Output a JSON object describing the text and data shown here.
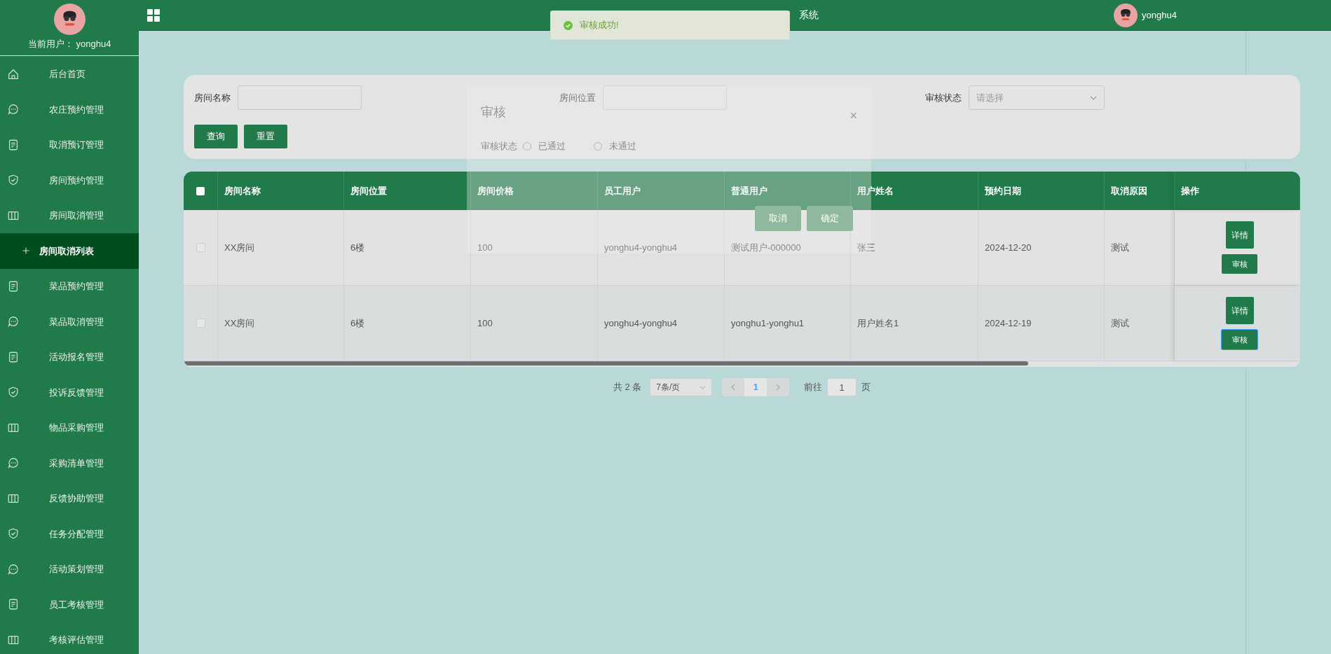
{
  "sidebar": {
    "current_user_label": "当前用户：",
    "current_user": "yonghu4",
    "items": [
      {
        "label": "后台首页",
        "kind": "home",
        "selected": false
      },
      {
        "label": "农庄预约管理",
        "kind": "chat",
        "selected": false
      },
      {
        "label": "取消预订管理",
        "kind": "doc",
        "selected": false
      },
      {
        "label": "房间预约管理",
        "kind": "shield",
        "selected": false
      },
      {
        "label": "房间取消管理",
        "kind": "columns",
        "selected": false
      },
      {
        "label": "房间取消列表",
        "kind": "sub",
        "selected": true
      },
      {
        "label": "菜品预约管理",
        "kind": "doc",
        "selected": false
      },
      {
        "label": "菜品取消管理",
        "kind": "chat",
        "selected": false
      },
      {
        "label": "活动报名管理",
        "kind": "doc",
        "selected": false
      },
      {
        "label": "投诉反馈管理",
        "kind": "shield",
        "selected": false
      },
      {
        "label": "物品采购管理",
        "kind": "columns",
        "selected": false
      },
      {
        "label": "采购清单管理",
        "kind": "chat",
        "selected": false
      },
      {
        "label": "反馈协助管理",
        "kind": "columns",
        "selected": false
      },
      {
        "label": "任务分配管理",
        "kind": "shield",
        "selected": false
      },
      {
        "label": "活动策划管理",
        "kind": "chat",
        "selected": false
      },
      {
        "label": "员工考核管理",
        "kind": "doc",
        "selected": false
      },
      {
        "label": "考核评估管理",
        "kind": "columns",
        "selected": false
      }
    ]
  },
  "header": {
    "title": "系统",
    "user": "yonghu4"
  },
  "toast": {
    "message": "审核成功!"
  },
  "search": {
    "fields": [
      {
        "label": "房间名称",
        "kind": "input"
      },
      {
        "label": "房间位置",
        "kind": "input"
      },
      {
        "label": "审核状态",
        "kind": "select",
        "placeholder": "请选择"
      }
    ],
    "buttons": [
      "查询",
      "重置"
    ]
  },
  "dialog": {
    "title": "审核",
    "close": "×",
    "field_label": "审核状态",
    "options": [
      {
        "label": "已通过",
        "selected": false
      },
      {
        "label": "未通过",
        "selected": false
      }
    ],
    "buttons": [
      "取消",
      "确定"
    ]
  },
  "table": {
    "select_all_checked": false,
    "columns": [
      "房间名称",
      "房间位置",
      "房间价格",
      "员工用户",
      "普通用户",
      "用户姓名",
      "预约日期",
      "取消原因",
      "操作"
    ],
    "rows": [
      {
        "checked": false,
        "cells": [
          "XX房间",
          "6楼",
          "100",
          "yonghu4-yonghu4",
          "测试用户-000000",
          "张三",
          "2024-12-20",
          "测试"
        ],
        "actions": [
          "详情",
          "审核"
        ]
      },
      {
        "checked": false,
        "cells": [
          "XX房间",
          "6楼",
          "100",
          "yonghu4-yonghu4",
          "yonghu1-yonghu1",
          "用户姓名1",
          "2024-12-19",
          "测试"
        ],
        "actions": [
          "详情",
          "审核"
        ]
      }
    ]
  },
  "pagination": {
    "total": "共 2 条",
    "page_size": "7条/页",
    "pages": [
      {
        "label": "1",
        "selected": true
      }
    ],
    "goto_label": "前往",
    "goto_value": "1",
    "goto_suffix": "页"
  }
}
